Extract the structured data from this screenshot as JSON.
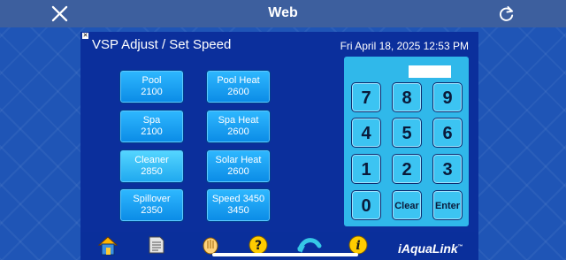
{
  "topbar": {
    "title": "Web"
  },
  "panel": {
    "title": "VSP Adjust / Set Speed",
    "datetime": "Fri April 18, 2025 12:53 PM"
  },
  "speeds": [
    {
      "label": "Pool",
      "value": "2100",
      "active": false
    },
    {
      "label": "Pool Heat",
      "value": "2600",
      "active": false
    },
    {
      "label": "Spa",
      "value": "2100",
      "active": false
    },
    {
      "label": "Spa Heat",
      "value": "2600",
      "active": false
    },
    {
      "label": "Cleaner",
      "value": "2850",
      "active": true
    },
    {
      "label": "Solar Heat",
      "value": "2600",
      "active": false
    },
    {
      "label": "Spillover",
      "value": "2350",
      "active": false
    },
    {
      "label": "Speed 3450",
      "value": "3450",
      "active": false
    }
  ],
  "keypad": {
    "keys": [
      "7",
      "8",
      "9",
      "4",
      "5",
      "6",
      "1",
      "2",
      "3",
      "0",
      "Clear",
      "Enter"
    ]
  },
  "toolbar": {
    "icons": [
      "home-icon",
      "document-icon",
      "hand-icon",
      "help-icon",
      "back-arrow-icon",
      "info-icon"
    ],
    "brand": "iAquaLink",
    "brand_mark": "™"
  },
  "colors": {
    "panel": "#0b2f9c",
    "button": "#1aa0f5",
    "keypad": "#30b8ea"
  }
}
